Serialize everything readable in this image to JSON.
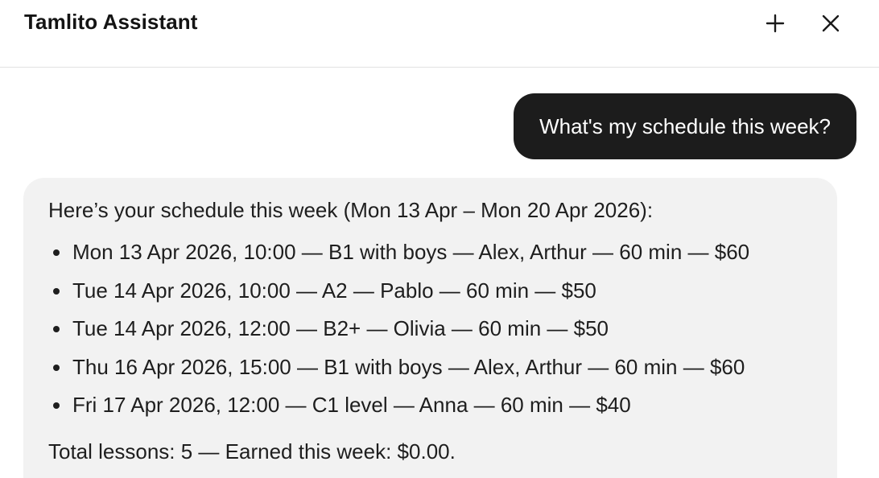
{
  "header": {
    "title": "Tamlito Assistant",
    "new_icon": "plus-icon",
    "close_icon": "close-icon"
  },
  "conversation": {
    "user_message": "What's my schedule this week?",
    "assistant": {
      "intro": "Here’s your schedule this week (Mon 13 Apr – Mon 20 Apr 2026):",
      "items": [
        "Mon 13 Apr 2026, 10:00 — B1 with boys — Alex, Arthur — 60 min — $60",
        "Tue 14 Apr 2026, 10:00 — A2 — Pablo — 60 min — $50",
        "Tue 14 Apr 2026, 12:00 — B2+ — Olivia — 60 min — $50",
        "Thu 16 Apr 2026, 15:00 — B1 with boys — Alex, Arthur — 60 min — $60",
        "Fri 17 Apr 2026, 12:00 — C1 level — Anna — 60 min — $40"
      ],
      "total": "Total lessons: 5 — Earned this week: $0.00."
    }
  },
  "colors": {
    "user_bubble_bg": "#1c1c1c",
    "assistant_bubble_bg": "#f2f2f2",
    "divider": "#e2e2e2"
  }
}
